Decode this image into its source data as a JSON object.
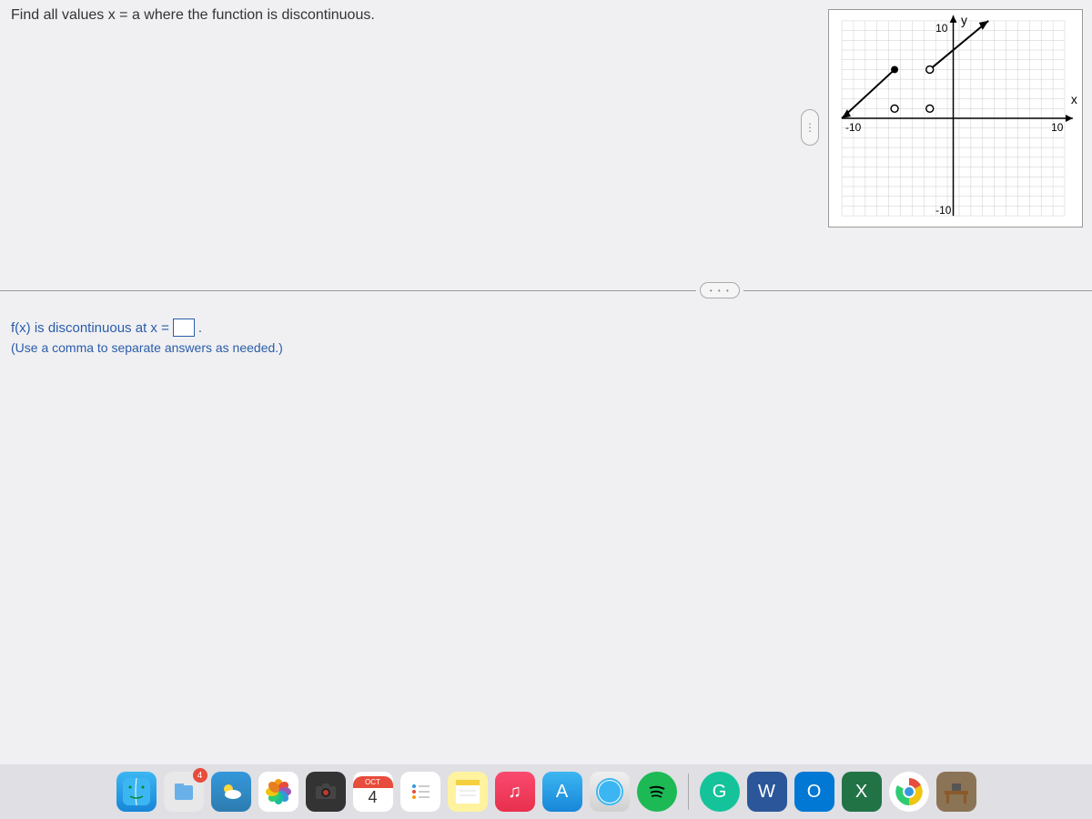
{
  "question": "Find all values x = a where the function is discontinuous.",
  "answer_prompt_prefix": "f(x) is discontinuous at x = ",
  "answer_prompt_suffix": ".",
  "answer_hint": "(Use a comma to separate answers as needed.)",
  "graph": {
    "x_label": "x",
    "y_label": "y",
    "x_min": -10,
    "x_max": 10,
    "y_min": -10,
    "y_max": 10,
    "tick_labels": {
      "x_neg": "-10",
      "x_pos": "10",
      "y_neg": "-10",
      "y_pos": "10"
    }
  },
  "chart_data": {
    "type": "line",
    "title": "",
    "xlabel": "x",
    "ylabel": "y",
    "xlim": [
      -10,
      10
    ],
    "ylim": [
      -10,
      10
    ],
    "series": [
      {
        "name": "left-segment",
        "description": "line segment with arrow at lower-left, ending with closed dot",
        "points": [
          [
            -10,
            0
          ],
          [
            -5,
            5
          ]
        ],
        "left_arrow": true,
        "right_endpoint": "closed"
      },
      {
        "name": "right-segment",
        "description": "line segment starting with open dot, arrow at upper-right",
        "points": [
          [
            -2,
            5
          ],
          [
            3,
            10
          ]
        ],
        "left_endpoint": "open",
        "right_arrow": true
      }
    ],
    "isolated_points": [
      {
        "x": -2,
        "y": 1,
        "type": "open"
      },
      {
        "x": -5,
        "y": 1,
        "type": "open"
      }
    ]
  },
  "dock": {
    "calendar_month": "OCT",
    "calendar_day": "4",
    "files_badge": "4",
    "icons": {
      "word": "W",
      "outlook": "O",
      "excel": "X",
      "grammarly": "G",
      "appstore": "A",
      "music": "♫",
      "spotify": "♪"
    }
  }
}
